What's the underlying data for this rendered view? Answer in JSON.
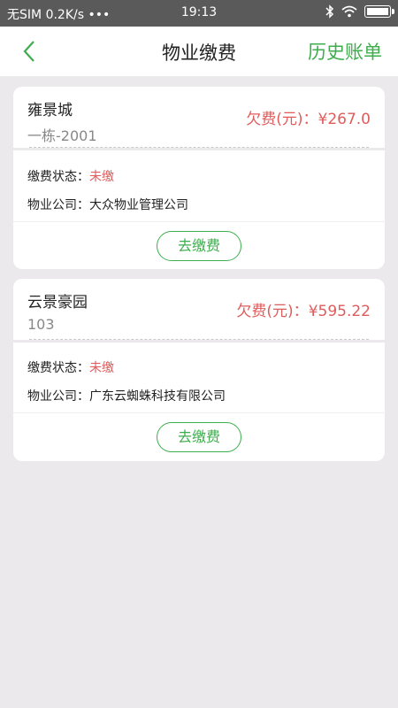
{
  "status_bar": {
    "carrier": "无SIM",
    "speed": "0.2K/s",
    "dots": "•••",
    "time": "19:13"
  },
  "nav": {
    "title": "物业缴费",
    "history_label": "历史账单"
  },
  "bills": [
    {
      "community": "雍景城",
      "unit": "一栋-2001",
      "owed_label": "欠费(元)：",
      "owed_amount": "¥267.0",
      "status_label": "缴费状态：",
      "status_value": "未缴",
      "company_label": "物业公司：",
      "company_value": "大众物业管理公司",
      "pay_label": "去缴费"
    },
    {
      "community": "云景豪园",
      "unit": "103",
      "owed_label": "欠费(元)：",
      "owed_amount": "¥595.22",
      "status_label": "缴费状态：",
      "status_value": "未缴",
      "company_label": "物业公司：",
      "company_value": "广东云蜘蛛科技有限公司",
      "pay_label": "去缴费"
    }
  ],
  "colors": {
    "accent": "#3eae4d",
    "owed": "#e05b5b",
    "background": "#ebe9ec"
  }
}
